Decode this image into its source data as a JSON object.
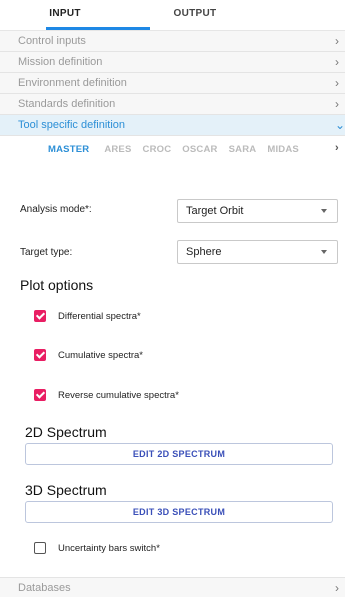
{
  "tabs": [
    {
      "label": "INPUT",
      "active": true
    },
    {
      "label": "OUTPUT",
      "active": false
    }
  ],
  "accordion": [
    {
      "label": "Control inputs"
    },
    {
      "label": "Mission definition"
    },
    {
      "label": "Environment definition"
    },
    {
      "label": "Standards definition"
    },
    {
      "label": "Tool specific definition",
      "expanded": true
    }
  ],
  "subtabs": [
    "MASTER",
    "ARES",
    "CROC",
    "OSCAR",
    "SARA",
    "MIDAS"
  ],
  "form": {
    "analysis_mode_label": "Analysis mode*:",
    "analysis_mode_value": "Target Orbit",
    "target_type_label": "Target type:",
    "target_type_value": "Sphere"
  },
  "plot_options": {
    "title": "Plot options",
    "checkboxes": [
      {
        "label": "Differential spectra*",
        "checked": true
      },
      {
        "label": "Cumulative spectra*",
        "checked": true
      },
      {
        "label": "Reverse cumulative spectra*",
        "checked": true
      }
    ]
  },
  "spectrum_2d": {
    "title": "2D Spectrum",
    "button": "EDIT 2D SPECTRUM"
  },
  "spectrum_3d": {
    "title": "3D Spectrum",
    "button": "EDIT 3D SPECTRUM"
  },
  "uncertainty": {
    "label": "Uncertainty bars switch*",
    "checked": false
  },
  "bottom": {
    "label": "Databases"
  },
  "colors": {
    "accent": "#1e88e5",
    "checkbox": "#e91e63",
    "active_row_bg": "#e4f1f9",
    "button_text": "#3a4fb8"
  }
}
